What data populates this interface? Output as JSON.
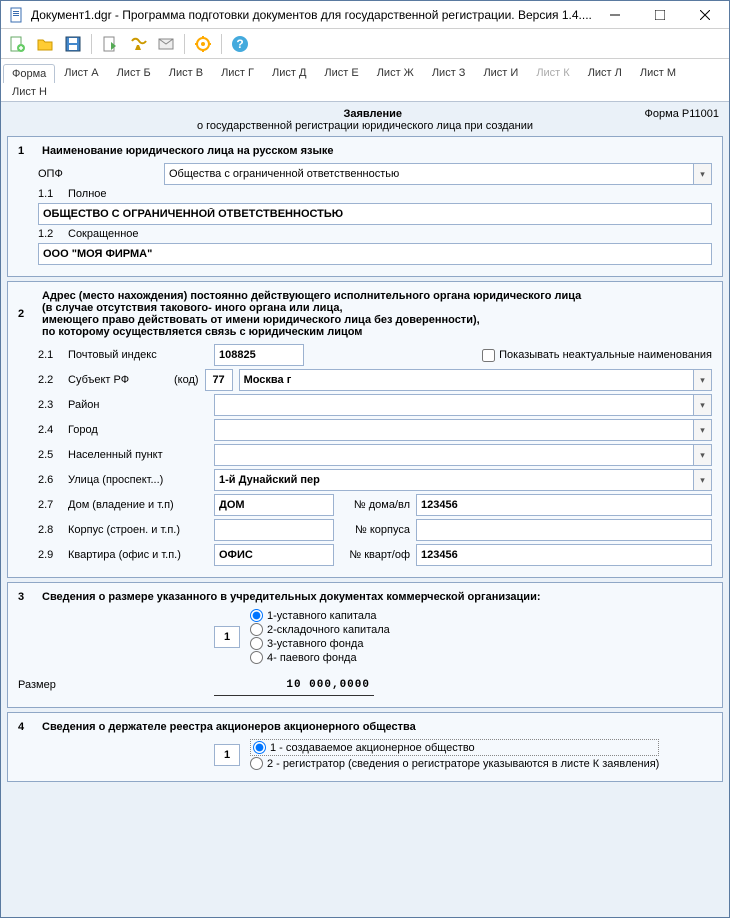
{
  "window": {
    "title": "Документ1.dgr - Программа подготовки документов для государственной регистрации. Версия 1.4...."
  },
  "tabs": [
    "Форма",
    "Лист А",
    "Лист Б",
    "Лист В",
    "Лист Г",
    "Лист Д",
    "Лист Е",
    "Лист Ж",
    "Лист З",
    "Лист И",
    "Лист К",
    "Лист Л",
    "Лист М",
    "Лист Н"
  ],
  "header": {
    "title": "Заявление",
    "subtitle": "о государственной регистрации юридического лица при создании",
    "form_code": "Форма Р11001"
  },
  "s1": {
    "num": "1",
    "title": "Наименование юридического лица на русском языке",
    "opf_label": "ОПФ",
    "opf_value": "Общества с ограниченной ответственностью",
    "full_num": "1.1",
    "full_label": "Полное",
    "full_value": "ОБЩЕСТВО С ОГРАНИЧЕННОЙ ОТВЕТСТВЕННОСТЬЮ",
    "short_num": "1.2",
    "short_label": "Сокращенное",
    "short_value": "ООО \"МОЯ ФИРМА\""
  },
  "s2": {
    "num": "2",
    "title_lines": [
      "Адрес (место нахождения) постоянно действующего исполнительного органа юридического лица",
      "(в случае отсутствия такового- иного органа или лица,",
      "имеющего право действовать от имени юридического лица без доверенности),",
      "по которому осуществляется связь с юридическим лицом"
    ],
    "show_old_label": "Показывать неактуальные наименования",
    "rows": {
      "r21": {
        "num": "2.1",
        "label": "Почтовый индекс",
        "value": "108825"
      },
      "r22": {
        "num": "2.2",
        "label": "Субъект РФ",
        "code_label": "(код)",
        "code": "77",
        "value": "Москва г"
      },
      "r23": {
        "num": "2.3",
        "label": "Район",
        "value": ""
      },
      "r24": {
        "num": "2.4",
        "label": "Город",
        "value": ""
      },
      "r25": {
        "num": "2.5",
        "label": "Населенный пункт",
        "value": ""
      },
      "r26": {
        "num": "2.6",
        "label": "Улица (проспект...)",
        "value": "1-й Дунайский пер"
      },
      "r27": {
        "num": "2.7",
        "label": "Дом (владение и т.п)",
        "type": "ДОМ",
        "num_label": "№ дома/вл",
        "num_value": "123456"
      },
      "r28": {
        "num": "2.8",
        "label": "Корпус (строен. и т.п.)",
        "type": "",
        "num_label": "№ корпуса",
        "num_value": ""
      },
      "r29": {
        "num": "2.9",
        "label": "Квартира (офис и т.п.)",
        "type": "ОФИС",
        "num_label": "№ кварт/оф",
        "num_value": "123456"
      }
    }
  },
  "s3": {
    "num": "3",
    "title": "Сведения о размере указанного в учредительных документах коммерческой организации:",
    "options": [
      "1-уставного капитала",
      "2-складочного капитала",
      "3-уставного фонда",
      "4- паевого фонда"
    ],
    "selected": "1",
    "size_label": "Размер",
    "size_value": "10 000,0000"
  },
  "s4": {
    "num": "4",
    "title": "Сведения о держателе реестра акционеров акционерного общества",
    "selected": "1",
    "options": [
      "1 - создаваемое акционерное общество",
      "2 - регистратор (сведения о регистраторе указываются в листе К заявления)"
    ]
  }
}
